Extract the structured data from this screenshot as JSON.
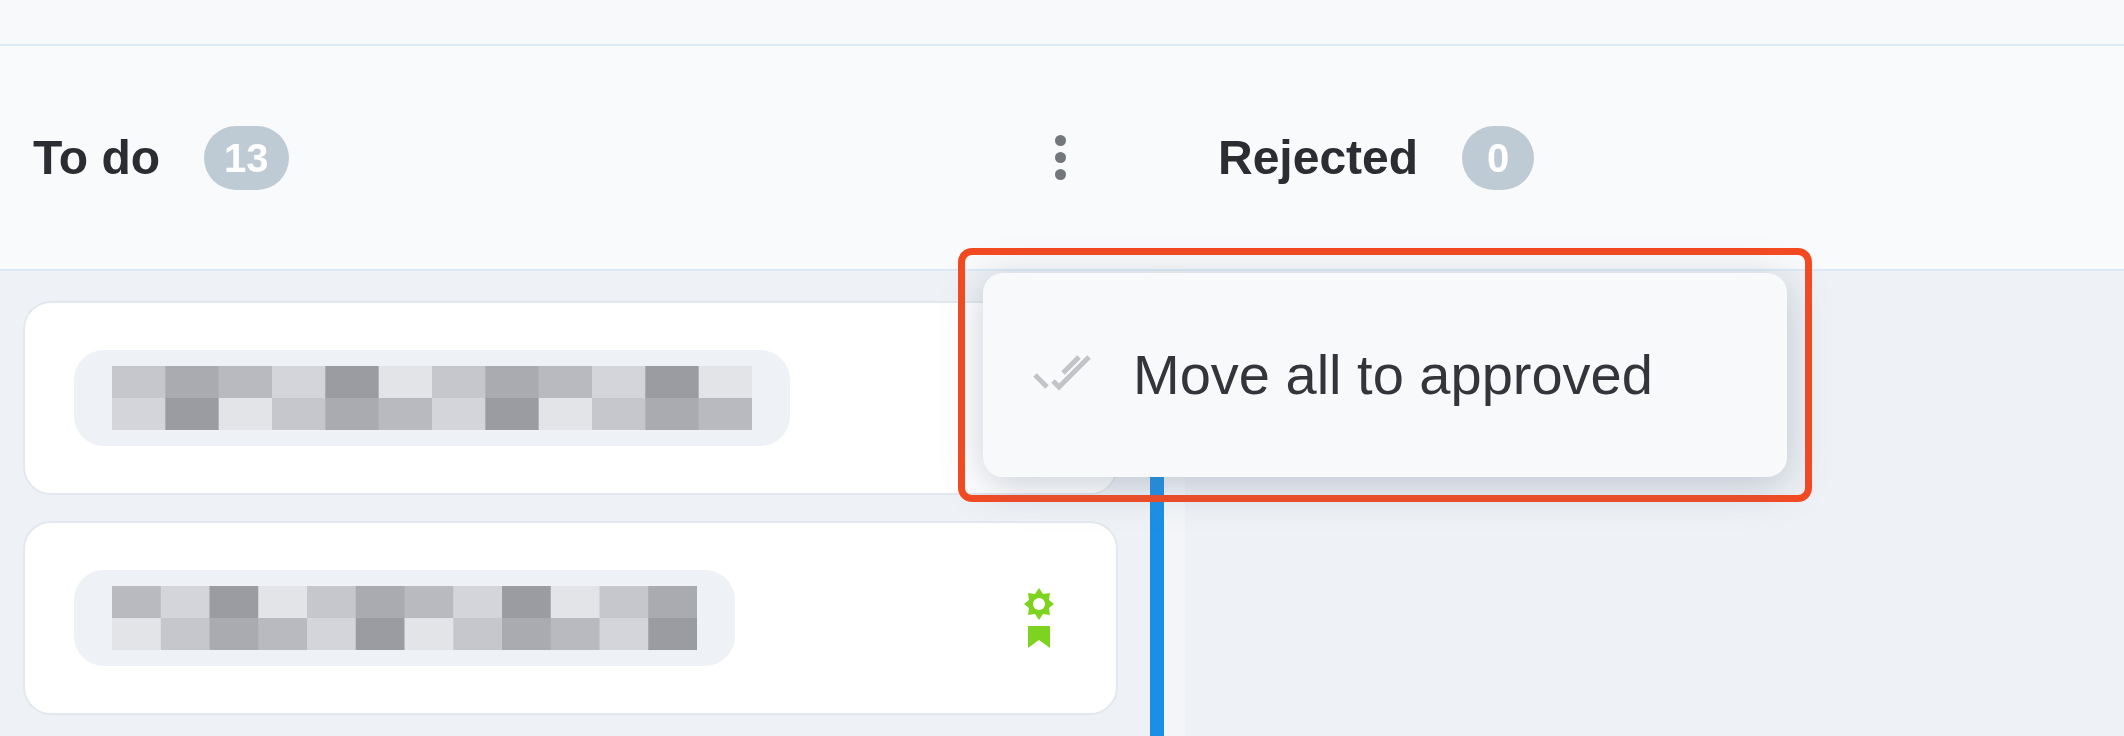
{
  "columns": [
    {
      "title": "To do",
      "count": "13",
      "cards": [
        {
          "kind": "picture"
        },
        {
          "kind": "picture",
          "award": true
        }
      ]
    },
    {
      "title": "Rejected",
      "count": "0"
    }
  ],
  "column_menu": {
    "items": [
      {
        "label": "Move all to approved"
      }
    ]
  }
}
